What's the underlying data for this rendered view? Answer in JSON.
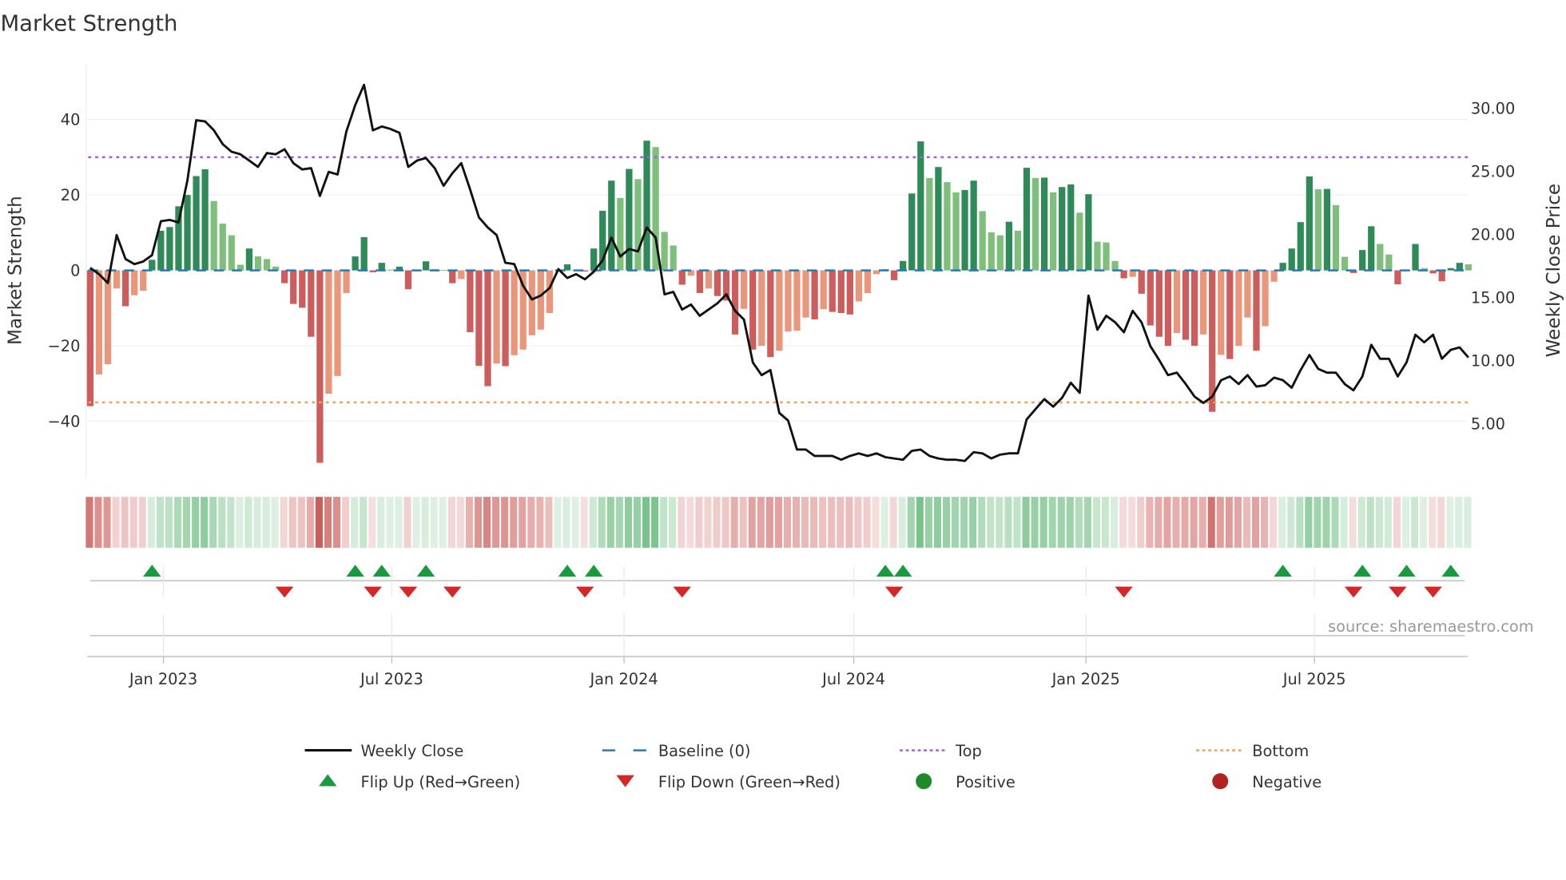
{
  "title": "Market Strength",
  "source": "source: sharemaestro.com",
  "chart_data": {
    "type": "bar+line",
    "title": "Market Strength",
    "ylabel_left": "Market Strength",
    "ylabel_right": "Weekly Close Price",
    "ylim_left": [
      -55,
      55
    ],
    "ylim_right": [
      1.1,
      33.9
    ],
    "left_ticks": [
      40,
      20,
      0,
      -20,
      -40
    ],
    "left_tick_labels": [
      "40",
      "20",
      "0",
      "−20",
      "−40"
    ],
    "right_ticks": [
      30,
      25,
      20,
      15,
      10,
      5
    ],
    "right_tick_labels": [
      "30.00",
      "25.00",
      "20.00",
      "15.00",
      "10.00",
      "5.00"
    ],
    "x_start": "2022-11-04",
    "x_step_days": 7,
    "x_ticks": [
      "2023-01-01",
      "2023-07-01",
      "2024-01-01",
      "2024-07-01",
      "2025-01-01",
      "2025-07-01"
    ],
    "x_tick_labels": [
      "Jan 2023",
      "Jul 2023",
      "Jan 2024",
      "Jul 2024",
      "Jan 2025",
      "Jul 2025"
    ],
    "top_level": 30,
    "bottom_level": -35,
    "baseline": 0,
    "strength": [
      -36,
      -27.6,
      -24.9,
      -4.8,
      -9.5,
      -6.6,
      -5.4,
      2.8,
      10.5,
      11.5,
      17,
      20,
      25,
      26.8,
      18.4,
      12.4,
      9.3,
      1.5,
      5.8,
      3.7,
      3,
      1,
      -3.4,
      -8.9,
      -9.9,
      -17.6,
      -51,
      -32.7,
      -28,
      -6,
      3.7,
      8.8,
      -0.5,
      2,
      0.2,
      1,
      -5,
      0.1,
      2.4,
      0.3,
      0.1,
      -3.4,
      -2.3,
      -16.4,
      -25.3,
      -30.7,
      -24.7,
      -25.4,
      -22.5,
      -21,
      -17.2,
      -15.7,
      -11.3,
      0.1,
      1.6,
      0.2,
      -0.3,
      5.8,
      15.8,
      23.8,
      19.2,
      26.9,
      24.2,
      34.4,
      32.7,
      10.2,
      6.6,
      -3.8,
      -1.4,
      -6,
      -4.8,
      -6.8,
      -8,
      -17,
      -10.2,
      -21,
      -20,
      -23,
      -21.3,
      -16.2,
      -16,
      -12.5,
      -13,
      -10.3,
      -11,
      -11.3,
      -11.7,
      -8.2,
      -6,
      -1,
      0.3,
      -2.6,
      2.5,
      20.4,
      34.2,
      24.5,
      27.4,
      23.4,
      20.7,
      21.3,
      23.8,
      15.7,
      10.1,
      9.3,
      12.9,
      10.5,
      27.2,
      24.5,
      24.6,
      20.7,
      22.1,
      22.8,
      15.3,
      20.2,
      7.6,
      7.4,
      2.5,
      -2.1,
      -1.7,
      -6.2,
      -14.6,
      -17.6,
      -20,
      -16.6,
      -18.4,
      -20,
      -17,
      -37.5,
      -22.4,
      -23.5,
      -20,
      -12.5,
      -21.3,
      -14.8,
      -3,
      2,
      5.8,
      12.8,
      24.9,
      21.5,
      21.6,
      17.3,
      3.6,
      -0.7,
      5.4,
      11.7,
      7,
      4.2,
      -3.7,
      0.1,
      7,
      0.6,
      -0.8,
      -2.9,
      0.6,
      2,
      1.6
    ],
    "weekly_close": [
      17.7,
      17.2,
      16.5,
      20.3,
      18.4,
      18.0,
      18.2,
      18.7,
      21.4,
      21.5,
      21.3,
      24.6,
      29.4,
      29.3,
      28.6,
      27.5,
      26.9,
      26.7,
      26.2,
      25.7,
      26.8,
      26.7,
      27.1,
      26.0,
      25.5,
      25.6,
      23.4,
      25.3,
      25.1,
      28.5,
      30.6,
      32.2,
      28.6,
      28.9,
      28.7,
      28.4,
      25.7,
      26.2,
      26.4,
      25.6,
      24.2,
      25.2,
      26.0,
      23.9,
      21.7,
      20.9,
      20.3,
      18.1,
      18.0,
      16.3,
      15.2,
      15.5,
      16.1,
      17.6,
      16.9,
      17.2,
      16.8,
      17.4,
      18.3,
      20.1,
      18.6,
      19.2,
      19.0,
      20.9,
      20.1,
      15.6,
      15.8,
      14.4,
      14.8,
      13.9,
      14.4,
      14.9,
      15.6,
      14.3,
      13.6,
      10.2,
      9.2,
      9.6,
      6.2,
      5.6,
      3.3,
      3.3,
      2.8,
      2.8,
      2.8,
      2.5,
      2.8,
      3.0,
      2.8,
      3.0,
      2.7,
      2.6,
      2.5,
      3.2,
      3.3,
      2.8,
      2.6,
      2.5,
      2.5,
      2.4,
      3.1,
      3.0,
      2.6,
      2.9,
      3.0,
      3.0,
      5.7,
      6.5,
      7.3,
      6.7,
      7.4,
      8.6,
      7.8,
      15.5,
      12.8,
      13.9,
      13.4,
      12.6,
      14.3,
      13.4,
      11.5,
      10.4,
      9.2,
      9.4,
      8.5,
      7.5,
      7.0,
      7.5,
      8.8,
      9.1,
      8.5,
      9.2,
      8.3,
      8.4,
      9.0,
      8.8,
      8.2,
      9.6,
      10.8,
      9.7,
      9.4,
      9.4,
      8.5,
      8.0,
      9.1,
      11.6,
      10.5,
      10.5,
      9.1,
      10.2,
      12.4,
      11.8,
      12.4,
      10.5,
      11.2,
      11.4,
      10.6
    ],
    "flip_up_weeks": [
      7,
      30,
      33,
      38,
      54,
      57,
      90,
      92,
      135,
      144,
      149,
      154
    ],
    "flip_down_weeks": [
      22,
      32,
      36,
      41,
      56,
      67,
      91,
      117,
      143,
      148,
      152
    ],
    "colors": {
      "positive_rising": "#2e8b57",
      "positive_falling": "#7fbf7b",
      "negative_falling": "#cd5c5c",
      "negative_rising": "#e9967a",
      "line": "#111111",
      "baseline": "#2a7ab0",
      "top": "#9b5fe0",
      "bottom": "#f5a05a",
      "flip_up": "#1a9a3e",
      "flip_down": "#d62728",
      "positive": "#1f8a2a",
      "negative": "#b22222"
    },
    "legend": {
      "placement": "bottom",
      "items": [
        {
          "key": "weekly_close",
          "label": "Weekly Close"
        },
        {
          "key": "baseline",
          "label": "Baseline (0)"
        },
        {
          "key": "top",
          "label": "Top"
        },
        {
          "key": "bottom",
          "label": "Bottom"
        },
        {
          "key": "flip_up",
          "label": "Flip Up (Red→Green)"
        },
        {
          "key": "flip_down",
          "label": "Flip Down (Green→Red)"
        },
        {
          "key": "positive",
          "label": "Positive"
        },
        {
          "key": "negative",
          "label": "Negative"
        }
      ]
    }
  }
}
